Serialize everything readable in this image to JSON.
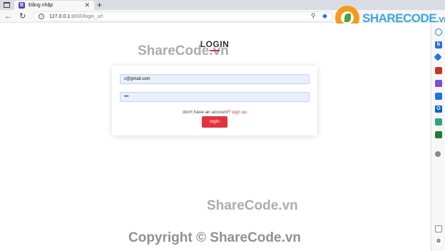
{
  "browser": {
    "tab_title": "Đăng nhập",
    "tab_favicon": "B",
    "url_host": "127.0.0.1",
    "url_path": ":8000/login_url"
  },
  "watermark": {
    "logo_text": "SHARECODE",
    "logo_suffix": ".vn",
    "center_text": "ShareCode.vn",
    "bottom_text": "ShareCode.vn",
    "copyright_text": "Copyright © ShareCode.vn"
  },
  "login": {
    "title": "LOGIN",
    "email_value": "c@gmail.com",
    "password_value": "•••",
    "signup_prompt": "don't have an account?",
    "signup_link": "sign up",
    "button_label": "login"
  },
  "colors": {
    "accent": "#e0343f",
    "field_bg": "#e8f0fd"
  },
  "icons": {
    "back": "back-arrow-icon",
    "refresh": "refresh-icon",
    "info": "info-icon",
    "search": "search-icon",
    "tag": "tag-icon"
  }
}
